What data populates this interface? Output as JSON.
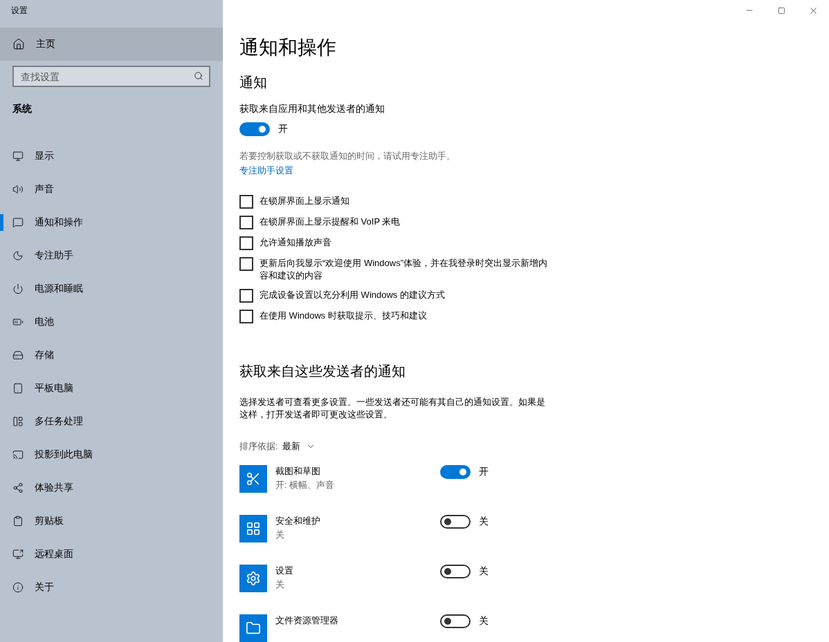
{
  "window": {
    "title": "设置"
  },
  "sidebar": {
    "home": {
      "label": "主页"
    },
    "search": {
      "placeholder": "查找设置"
    },
    "section": "系统",
    "items": [
      {
        "label": "显示",
        "kind": "display",
        "selected": false
      },
      {
        "label": "声音",
        "kind": "sound",
        "selected": false
      },
      {
        "label": "通知和操作",
        "kind": "notifications",
        "selected": true
      },
      {
        "label": "专注助手",
        "kind": "focus",
        "selected": false
      },
      {
        "label": "电源和睡眠",
        "kind": "power",
        "selected": false
      },
      {
        "label": "电池",
        "kind": "battery",
        "selected": false
      },
      {
        "label": "存储",
        "kind": "storage",
        "selected": false
      },
      {
        "label": "平板电脑",
        "kind": "tablet",
        "selected": false
      },
      {
        "label": "多任务处理",
        "kind": "multitask",
        "selected": false
      },
      {
        "label": "投影到此电脑",
        "kind": "project",
        "selected": false
      },
      {
        "label": "体验共享",
        "kind": "share",
        "selected": false
      },
      {
        "label": "剪贴板",
        "kind": "clipboard",
        "selected": false
      },
      {
        "label": "远程桌面",
        "kind": "remote",
        "selected": false
      },
      {
        "label": "关于",
        "kind": "about",
        "selected": false
      }
    ]
  },
  "page": {
    "title": "通知和操作",
    "notifications": {
      "heading": "通知",
      "toggle_title": "获取来自应用和其他发送者的通知",
      "toggle": {
        "on": true,
        "label": "开"
      },
      "hint": "若要控制获取或不获取通知的时间，请试用专注助手。",
      "link": "专注助手设置",
      "options": [
        {
          "label": "在锁屏界面上显示通知",
          "checked": false
        },
        {
          "label": "在锁屏界面上显示提醒和 VoIP 来电",
          "checked": false
        },
        {
          "label": "允许通知播放声音",
          "checked": false
        },
        {
          "label": "更新后向我显示“欢迎使用 Windows”体验，并在我登录时突出显示新增内容和建议的内容",
          "checked": false
        },
        {
          "label": "完成设备设置以充分利用 Windows 的建议方式",
          "checked": false
        },
        {
          "label": "在使用 Windows 时获取提示、技巧和建议",
          "checked": false
        }
      ]
    },
    "senders": {
      "heading": "获取来自这些发送者的通知",
      "description": "选择发送者可查看更多设置。一些发送者还可能有其自己的通知设置。如果是这样，打开发送者即可更改这些设置。",
      "sort_label": "排序依据:",
      "sort_value": "最新",
      "apps": [
        {
          "name": "截图和草图",
          "status": "开: 横幅、声音",
          "kind": "snip",
          "on": true,
          "toggle_label": "开"
        },
        {
          "name": "安全和维护",
          "status": "关",
          "kind": "security",
          "on": false,
          "toggle_label": "关"
        },
        {
          "name": "设置",
          "status": "关",
          "kind": "settings",
          "on": false,
          "toggle_label": "关"
        },
        {
          "name": "文件资源管理器",
          "kind": "explorer",
          "on": false,
          "toggle_label": "关"
        }
      ]
    }
  }
}
